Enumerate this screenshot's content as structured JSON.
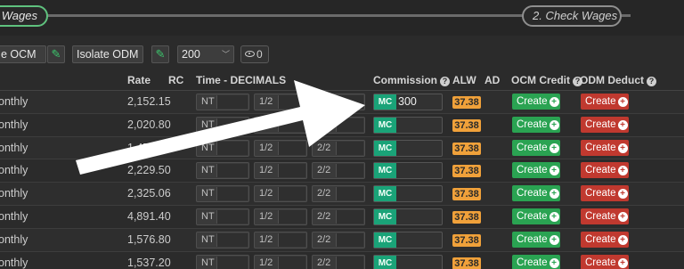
{
  "wizard": {
    "step1_label": "t Wages",
    "step2_label": "2. Check Wages"
  },
  "filters": {
    "ocm_select": "e OCM",
    "odm_select": "Isolate ODM",
    "page_size": "200",
    "hidden_count": "0"
  },
  "table": {
    "headers": {
      "rate": "Rate",
      "rc": "RC",
      "time": "Time - DECIMALS",
      "commission": "Commission",
      "alw": "ALW",
      "ad": "AD",
      "ocm_credit": "OCM Credit",
      "odm_deduct": "ODM Deduct"
    },
    "rows": [
      {
        "period": "onthly",
        "rate": "2,152.15",
        "nt": "NT",
        "half": "1/2",
        "two": "2/2",
        "mc": "MC",
        "commission": "300",
        "alw": "37.38",
        "ocm": "Create",
        "odm": "Create"
      },
      {
        "period": "onthly",
        "rate": "2,020.80",
        "nt": "NT",
        "half": "1/2",
        "two": "2/2",
        "mc": "MC",
        "commission": "",
        "alw": "37.38",
        "ocm": "Create",
        "odm": "Create"
      },
      {
        "period": "onthly",
        "rate": "1,478.40",
        "nt": "NT",
        "half": "1/2",
        "two": "2/2",
        "mc": "MC",
        "commission": "",
        "alw": "37.38",
        "ocm": "Create",
        "odm": "Create"
      },
      {
        "period": "onthly",
        "rate": "2,229.50",
        "nt": "NT",
        "half": "1/2",
        "two": "2/2",
        "mc": "MC",
        "commission": "",
        "alw": "37.38",
        "ocm": "Create",
        "odm": "Create"
      },
      {
        "period": "onthly",
        "rate": "2,325.06",
        "nt": "NT",
        "half": "1/2",
        "two": "2/2",
        "mc": "MC",
        "commission": "",
        "alw": "37.38",
        "ocm": "Create",
        "odm": "Create"
      },
      {
        "period": "onthly",
        "rate": "4,891.40",
        "nt": "NT",
        "half": "1/2",
        "two": "2/2",
        "mc": "MC",
        "commission": "",
        "alw": "37.38",
        "ocm": "Create",
        "odm": "Create"
      },
      {
        "period": "onthly",
        "rate": "1,576.80",
        "nt": "NT",
        "half": "1/2",
        "two": "2/2",
        "mc": "MC",
        "commission": "",
        "alw": "37.38",
        "ocm": "Create",
        "odm": "Create"
      },
      {
        "period": "onthly",
        "rate": "1,537.20",
        "nt": "NT",
        "half": "1/2",
        "two": "2/2",
        "mc": "MC",
        "commission": "",
        "alw": "37.38",
        "ocm": "Create",
        "odm": "Create"
      }
    ]
  },
  "icons": {
    "edit": "pencil-icon",
    "visibility": "eye-icon",
    "help": "question-circle-icon",
    "add": "plus-circle-icon",
    "annotation": "arrow-annotation"
  },
  "colors": {
    "mc_badge": "#1aa378",
    "alw_badge": "#f0a13a",
    "ocm_create": "#2aa352",
    "odm_create": "#c0392f",
    "step_active": "#5fc27e"
  }
}
